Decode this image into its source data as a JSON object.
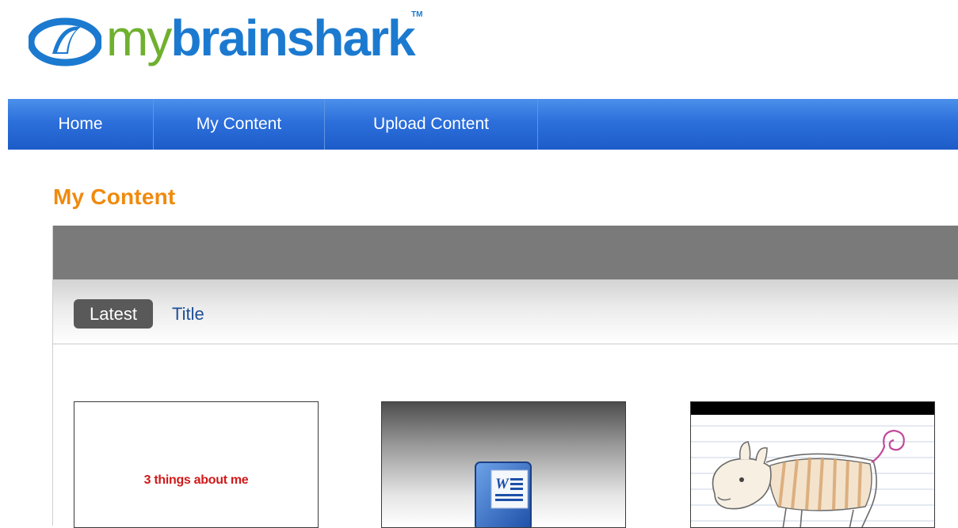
{
  "logo": {
    "my": "my",
    "brainshark": "brainshark",
    "tm": "TM"
  },
  "nav": {
    "items": [
      {
        "label": "Home"
      },
      {
        "label": "My Content"
      },
      {
        "label": "Upload Content"
      }
    ]
  },
  "page": {
    "title": "My Content"
  },
  "sort": {
    "options": [
      {
        "label": "Latest",
        "selected": true
      },
      {
        "label": "Title",
        "selected": false
      }
    ]
  },
  "content_items": [
    {
      "thumbnail_text": "3 things about me",
      "icon": "slide-thumbnail"
    },
    {
      "icon": "word-document-icon"
    },
    {
      "icon": "zebra-drawing-thumbnail"
    }
  ],
  "colors": {
    "nav_blue": "#2c6fdb",
    "title_orange": "#f08a0e",
    "logo_green": "#6fb02e",
    "logo_blue": "#1b7ad0",
    "panel_header_gray": "#7a7a7a",
    "selected_tab_dark": "#595959",
    "link_blue": "#1f4f96",
    "thumbnail_red_text": "#d01a1a"
  }
}
